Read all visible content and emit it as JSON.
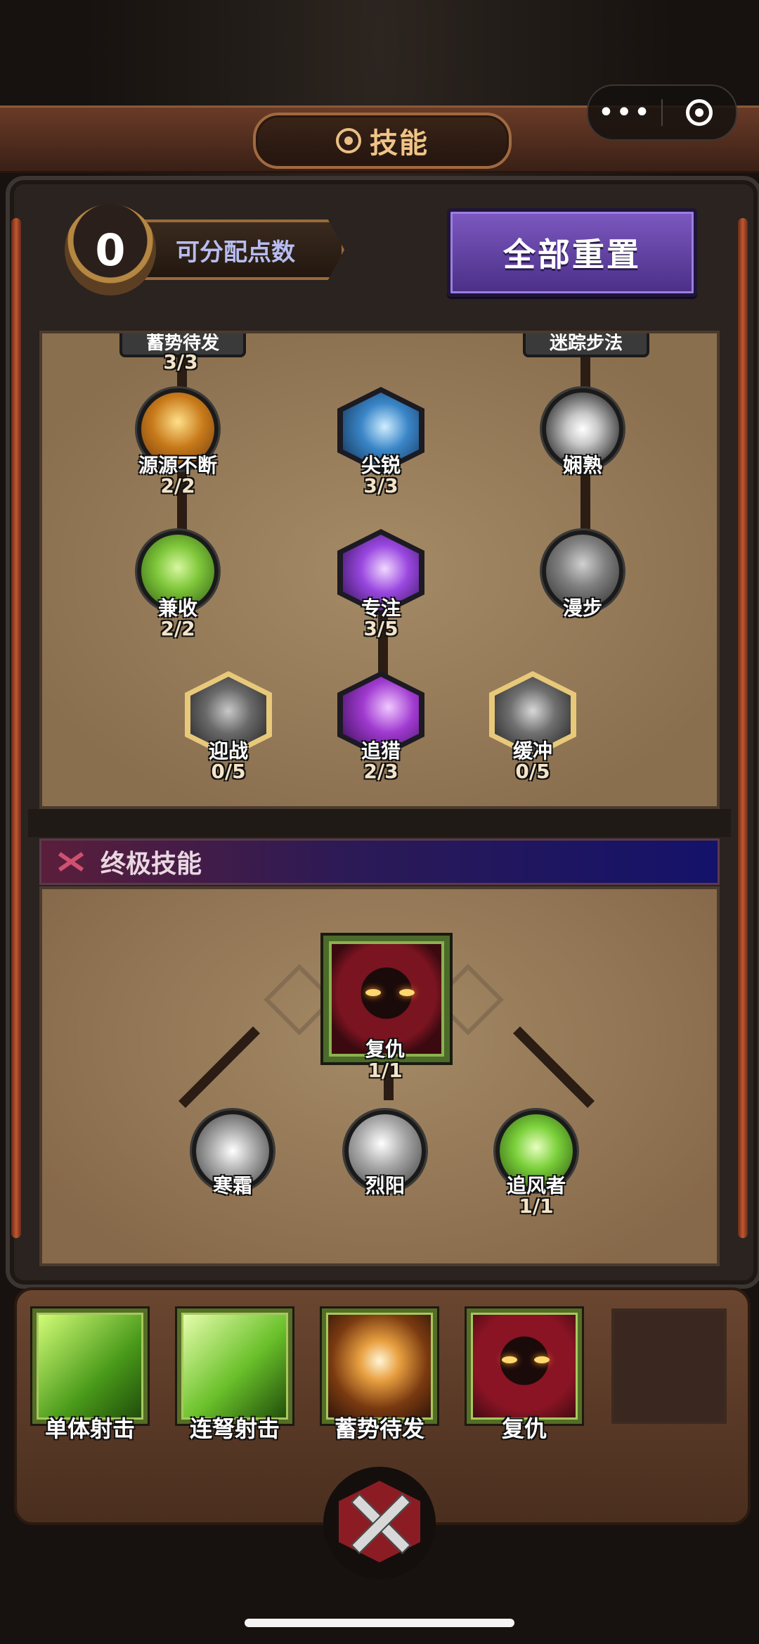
{
  "header": {
    "title": "技能"
  },
  "capsule": {
    "more": "•••",
    "more_icon": "more-dots-icon",
    "target_icon": "target-icon"
  },
  "points": {
    "value": "0",
    "label": "可分配点数"
  },
  "reset_button": {
    "label": "全部重置"
  },
  "tree": {
    "top_tags": [
      "蓄势待发",
      "迷踪步法"
    ],
    "top_count": "3/3",
    "nodes": [
      {
        "name": "源源不断",
        "count": "2/2"
      },
      {
        "name": "尖锐",
        "count": "3/3"
      },
      {
        "name": "娴熟",
        "count": ""
      },
      {
        "name": "兼收",
        "count": "2/2"
      },
      {
        "name": "专注",
        "count": "3/5"
      },
      {
        "name": "漫步",
        "count": ""
      },
      {
        "name": "迎战",
        "count": "0/5"
      },
      {
        "name": "追猎",
        "count": "2/3"
      },
      {
        "name": "缓冲",
        "count": "0/5"
      }
    ]
  },
  "ultimate": {
    "header": "终极技能",
    "main": {
      "name": "复仇",
      "count": "1/1"
    },
    "branches": [
      {
        "name": "寒霜",
        "count": ""
      },
      {
        "name": "烈阳",
        "count": ""
      },
      {
        "name": "追风者",
        "count": "1/1"
      }
    ]
  },
  "skillbar": {
    "slots": [
      {
        "label": "单体射击"
      },
      {
        "label": "连弩射击"
      },
      {
        "label": "蓄势待发"
      },
      {
        "label": "复仇"
      }
    ]
  },
  "colors": {
    "accent_gold": "#f0c486",
    "reset_purple": "#6a4aa8",
    "points_label": "#b7bdf0"
  }
}
